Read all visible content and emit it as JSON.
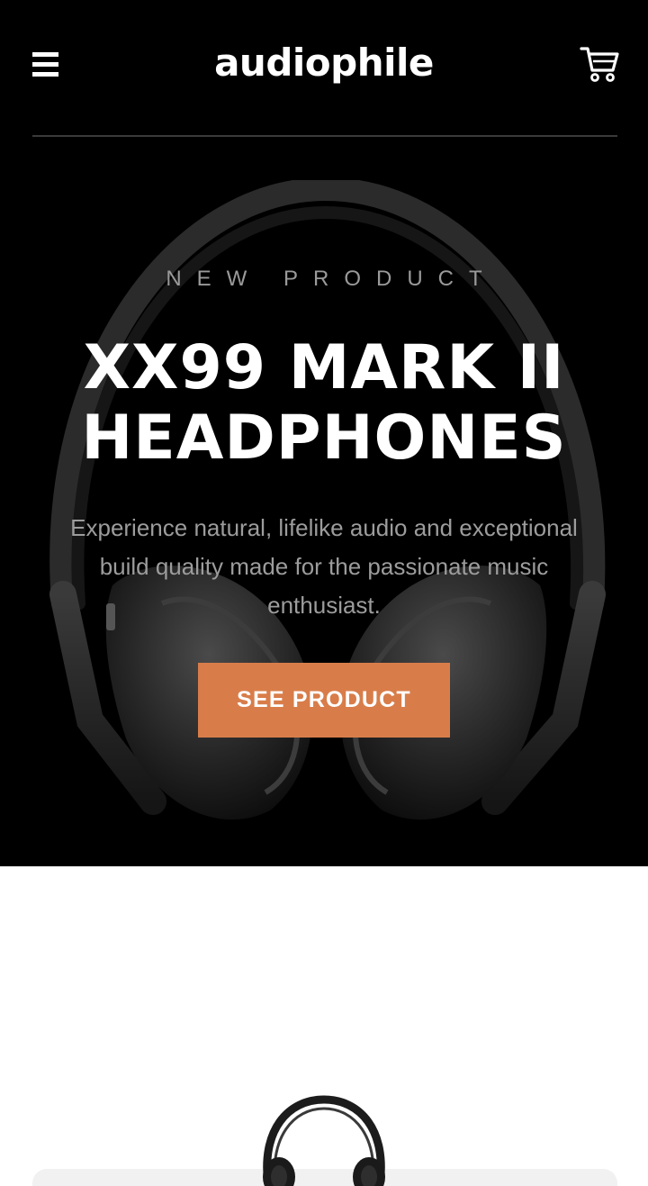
{
  "header": {
    "logo": "audiophile",
    "menu_icon": "hamburger-menu-icon",
    "cart_icon": "shopping-cart-icon"
  },
  "hero": {
    "eyebrow": "NEW PRODUCT",
    "title_line1": "XX99 MARK II",
    "title_line2": "HEADPHONES",
    "description": "Experience natural, lifelike audio and exceptional build quality made for the passionate music enthusiast.",
    "cta_label": "SEE PRODUCT",
    "image": "headphones-image"
  },
  "category_card": {
    "image": "headphones-image"
  },
  "colors": {
    "hero_background": "#000000",
    "accent": "#D87D4A",
    "text_light": "#FFFFFF",
    "text_muted": "#9C9C9C",
    "card_background": "#F1F1F1"
  }
}
